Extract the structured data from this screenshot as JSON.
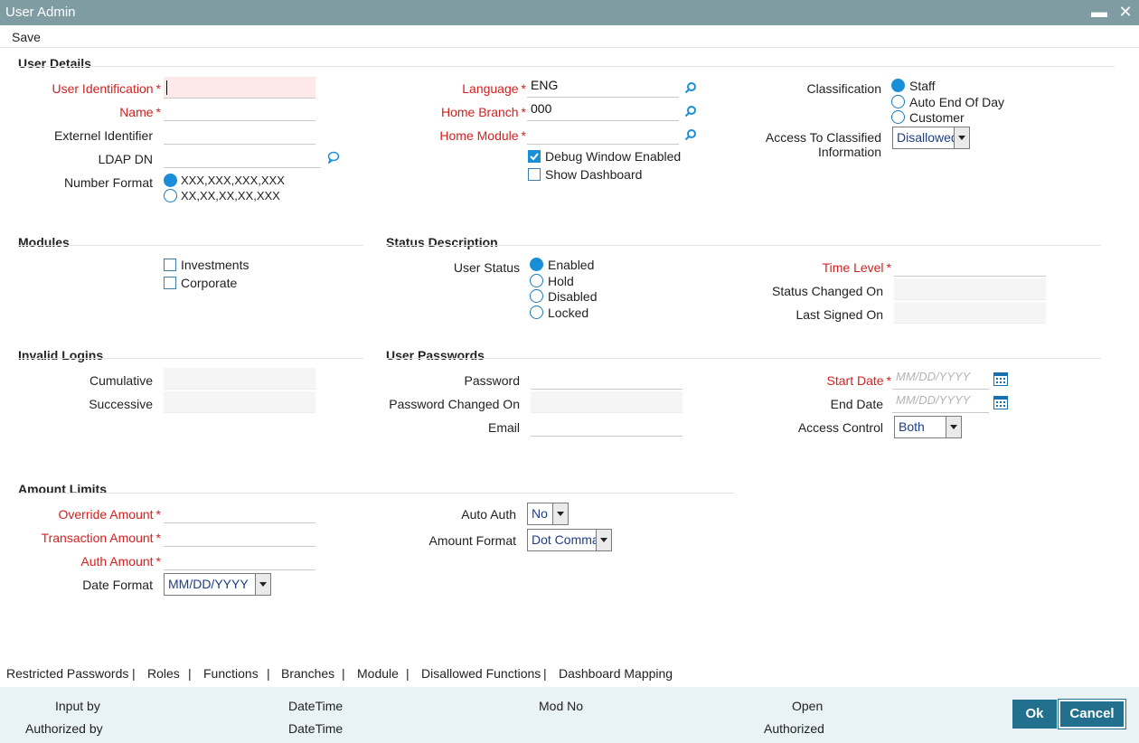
{
  "window": {
    "title": "User Admin",
    "minimize": "▬",
    "close": "✕"
  },
  "toolbar": {
    "save_label": "Save"
  },
  "sections": {
    "user_details": "User Details",
    "modules": "Modules",
    "status_description": "Status Description",
    "invalid_logins": "Invalid Logins",
    "user_passwords": "User Passwords",
    "amount_limits": "Amount Limits"
  },
  "user_details": {
    "user_id_label": "User Identification",
    "user_id_value": "",
    "name_label": "Name",
    "name_value": "",
    "external_id_label": "Externel Identifier",
    "external_id_value": "",
    "ldap_label": "LDAP DN",
    "ldap_value": "",
    "number_format_label": "Number Format",
    "number_format_options": [
      "XXX,XXX,XXX,XXX",
      "XX,XX,XX,XX,XXX"
    ],
    "number_format_selected": 0,
    "language_label": "Language",
    "language_value": "ENG",
    "home_branch_label": "Home Branch",
    "home_branch_value": "000",
    "home_module_label": "Home Module",
    "home_module_value": "",
    "debug_window_label": "Debug Window Enabled",
    "debug_window_checked": true,
    "show_dashboard_label": "Show Dashboard",
    "show_dashboard_checked": false,
    "classification_label": "Classification",
    "classification_options": [
      "Staff",
      "Auto End Of Day",
      "Customer"
    ],
    "classification_selected": 0,
    "access_classified_label_1": "Access To Classified",
    "access_classified_label_2": "Information",
    "access_classified_value": "Disallowed"
  },
  "modules": {
    "items": [
      {
        "label": "Investments",
        "checked": false
      },
      {
        "label": "Corporate",
        "checked": false
      }
    ]
  },
  "status": {
    "user_status_label": "User Status",
    "options": [
      "Enabled",
      "Hold",
      "Disabled",
      "Locked"
    ],
    "selected": 0,
    "time_level_label": "Time Level",
    "time_level_value": "",
    "status_changed_label": "Status Changed On",
    "status_changed_value": "",
    "last_signed_label": "Last Signed On",
    "last_signed_value": ""
  },
  "invalid_logins": {
    "cumulative_label": "Cumulative",
    "cumulative_value": "",
    "successive_label": "Successive",
    "successive_value": ""
  },
  "passwords": {
    "password_label": "Password",
    "password_value": "",
    "changed_on_label": "Password Changed On",
    "changed_on_value": "",
    "email_label": "Email",
    "email_value": "",
    "start_date_label": "Start Date",
    "start_date_placeholder": "MM/DD/YYYY",
    "end_date_label": "End Date",
    "end_date_placeholder": "MM/DD/YYYY",
    "access_control_label": "Access Control",
    "access_control_value": "Both"
  },
  "amount_limits": {
    "override_label": "Override Amount",
    "override_value": "",
    "transaction_label": "Transaction Amount",
    "transaction_value": "",
    "auth_amount_label": "Auth Amount",
    "auth_amount_value": "",
    "date_format_label": "Date Format",
    "date_format_value": "MM/DD/YYYY",
    "auto_auth_label": "Auto Auth",
    "auto_auth_value": "No",
    "amount_format_label": "Amount Format",
    "amount_format_value": "Dot Comma"
  },
  "tabs": [
    "Restricted Passwords",
    "Roles",
    "Functions",
    "Branches",
    "Module",
    "Disallowed Functions",
    "Dashboard Mapping"
  ],
  "tab_separator": "|",
  "footer": {
    "input_by": "Input by",
    "authorized_by": "Authorized by",
    "datetime_1": "DateTime",
    "datetime_2": "DateTime",
    "mod_no": "Mod No",
    "open": "Open",
    "authorized": "Authorized",
    "ok_label": "Ok",
    "cancel_label": "Cancel"
  },
  "colors": {
    "titlebar": "#7f9ca3",
    "required": "#d42020",
    "accent": "#1a8fd8",
    "button": "#22708d",
    "footer_bg": "#e9f3f5"
  },
  "icons": {
    "lookup": "search-icon",
    "comment": "chat-bubble-icon",
    "date": "calendar-icon"
  }
}
